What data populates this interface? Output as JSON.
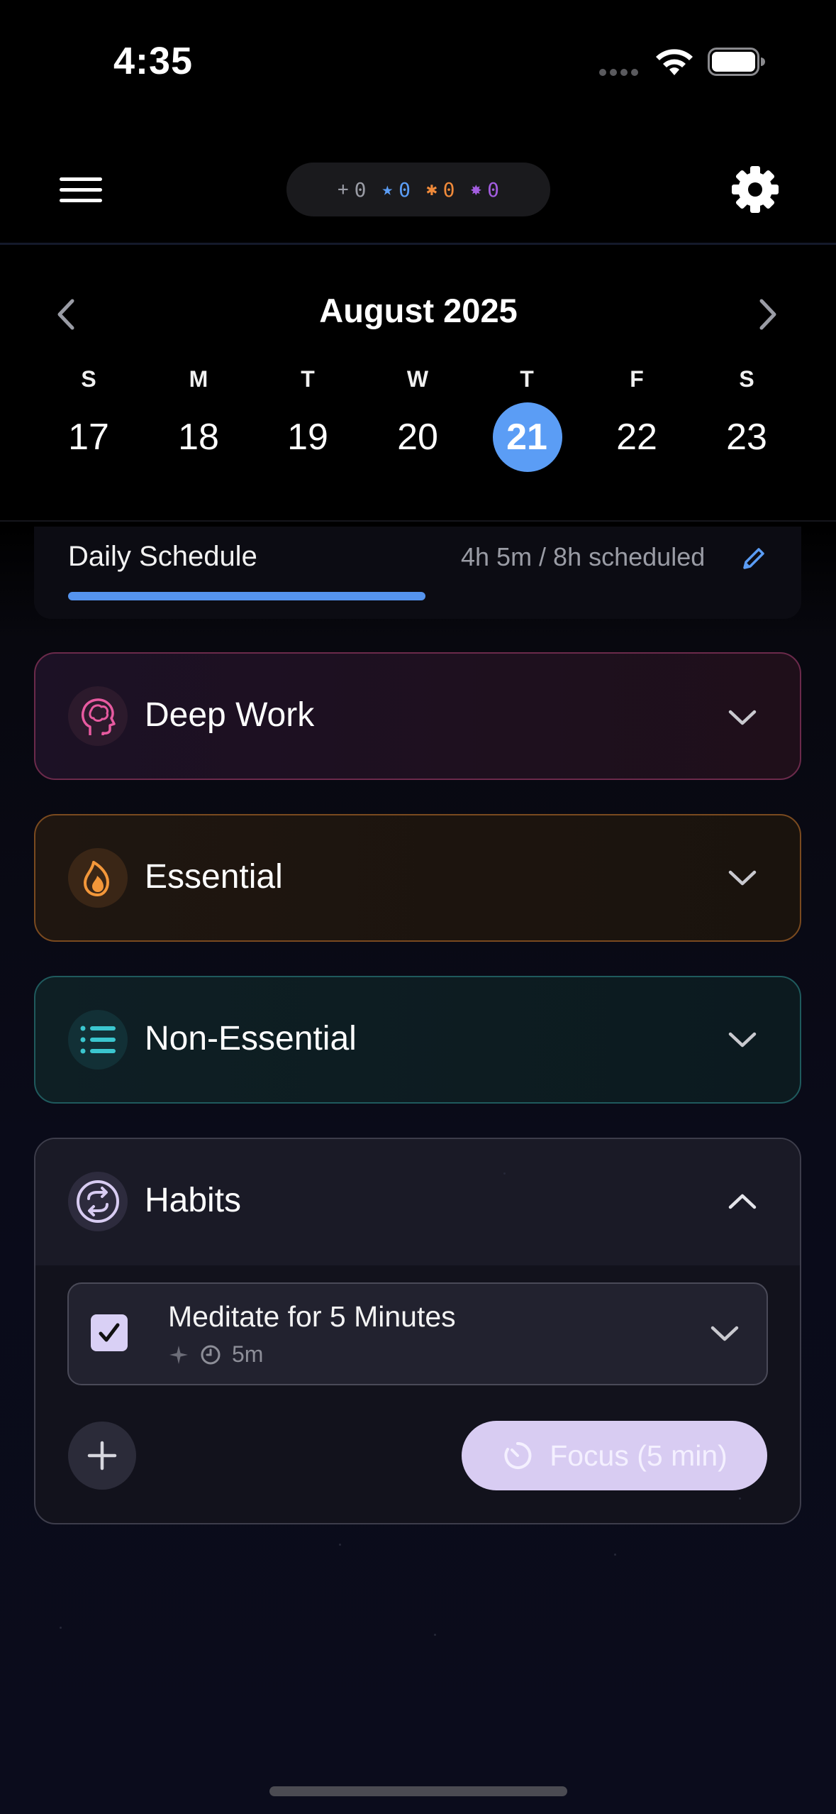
{
  "status_bar": {
    "time": "4:35"
  },
  "points": [
    {
      "icon": "sparkle-icon",
      "value": "0",
      "color": "#9a9ca5",
      "glyph": "+"
    },
    {
      "icon": "star-icon",
      "value": "0",
      "color": "#5b9df5",
      "glyph": "★"
    },
    {
      "icon": "burst-icon",
      "value": "0",
      "color": "#f08a3a",
      "glyph": "✱"
    },
    {
      "icon": "badge-icon",
      "value": "0",
      "color": "#a35de0",
      "glyph": "✸"
    }
  ],
  "calendar": {
    "month_label": "August 2025",
    "days": [
      {
        "dow": "S",
        "date": "17"
      },
      {
        "dow": "M",
        "date": "18"
      },
      {
        "dow": "T",
        "date": "19"
      },
      {
        "dow": "W",
        "date": "20"
      },
      {
        "dow": "T",
        "date": "21",
        "selected": true
      },
      {
        "dow": "F",
        "date": "22"
      },
      {
        "dow": "S",
        "date": "23"
      }
    ]
  },
  "schedule": {
    "title": "Daily Schedule",
    "summary": "4h 5m / 8h scheduled",
    "progress": 0.51
  },
  "categories": [
    {
      "label": "Deep Work",
      "icon": "brain-head-icon",
      "accent": "#e75aa0",
      "expanded": false
    },
    {
      "label": "Essential",
      "icon": "flame-icon",
      "accent": "#f3973a",
      "expanded": false
    },
    {
      "label": "Non-Essential",
      "icon": "list-icon",
      "accent": "#3bc6cf",
      "expanded": false
    },
    {
      "label": "Habits",
      "icon": "repeat-icon",
      "accent": "#d8ccf2",
      "expanded": true
    }
  ],
  "habit": {
    "title": "Meditate for 5 Minutes",
    "duration": "5m",
    "checked": true
  },
  "focus_button": {
    "label": "Focus (5 min)"
  }
}
